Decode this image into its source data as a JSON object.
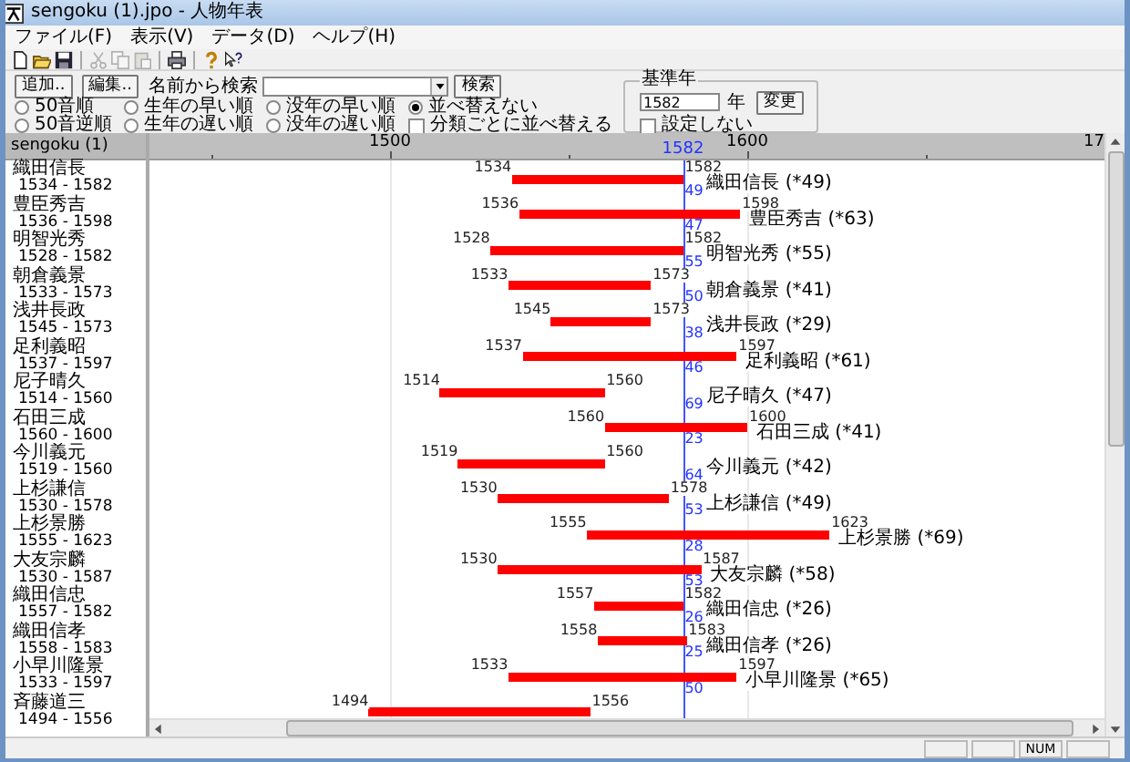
{
  "window": {
    "title": "sengoku (1).jpo - 人物年表"
  },
  "menu": [
    {
      "label": "ファイル(F)"
    },
    {
      "label": "表示(V)"
    },
    {
      "label": "データ(D)"
    },
    {
      "label": "ヘルプ(H)"
    }
  ],
  "toolbar": [
    {
      "kind": "new",
      "disabled": false
    },
    {
      "kind": "open",
      "disabled": false
    },
    {
      "kind": "save",
      "disabled": false
    },
    {
      "kind": "sep"
    },
    {
      "kind": "cut",
      "disabled": true
    },
    {
      "kind": "copy",
      "disabled": true
    },
    {
      "kind": "paste",
      "disabled": true
    },
    {
      "kind": "sep"
    },
    {
      "kind": "print",
      "disabled": false
    },
    {
      "kind": "sep"
    },
    {
      "kind": "help",
      "disabled": false
    },
    {
      "kind": "context-help",
      "disabled": false
    }
  ],
  "controls": {
    "buttons": [
      "追加..",
      "編集.."
    ],
    "search_label": "名前から検索",
    "search_button": "検索",
    "sort_options": [
      {
        "label": "50音順",
        "selected": false
      },
      {
        "label": "50音逆順",
        "selected": false
      },
      {
        "label": "生年の早い順",
        "selected": false
      },
      {
        "label": "生年の遅い順",
        "selected": false
      },
      {
        "label": "没年の早い順",
        "selected": false
      },
      {
        "label": "没年の遅い順",
        "selected": false
      },
      {
        "label": "並べ替えない",
        "selected": true
      }
    ],
    "group_sort": {
      "label": "分類ごとに並べ替える",
      "checked": false
    }
  },
  "base_year": {
    "title": "基準年",
    "value": "1582",
    "unit": "年",
    "button": "変更",
    "no_set": {
      "label": "設定しない",
      "checked": false
    }
  },
  "list": {
    "header": "sengoku (1)",
    "items": [
      {
        "name": "織田信長",
        "years": "1534 - 1582"
      },
      {
        "name": "豊臣秀吉",
        "years": "1536 - 1598"
      },
      {
        "name": "明智光秀",
        "years": "1528 - 1582"
      },
      {
        "name": "朝倉義景",
        "years": "1533 - 1573"
      },
      {
        "name": "浅井長政",
        "years": "1545 - 1573"
      },
      {
        "name": "足利義昭",
        "years": "1537 - 1597"
      },
      {
        "name": "尼子晴久",
        "years": "1514 - 1560"
      },
      {
        "name": "石田三成",
        "years": "1560 - 1600"
      },
      {
        "name": "今川義元",
        "years": "1519 - 1560"
      },
      {
        "name": "上杉謙信",
        "years": "1530 - 1578"
      },
      {
        "name": "上杉景勝",
        "years": "1555 - 1623"
      },
      {
        "name": "大友宗麟",
        "years": "1530 - 1587"
      },
      {
        "name": "織田信忠",
        "years": "1557 - 1582"
      },
      {
        "name": "織田信孝",
        "years": "1558 - 1583"
      },
      {
        "name": "小早川隆景",
        "years": "1533 - 1597"
      },
      {
        "name": "斉藤道三",
        "years": "1494 - 1556"
      }
    ]
  },
  "timeline": {
    "axis": [
      "1500",
      "1600",
      "17"
    ],
    "reference": "1582",
    "rows": [
      {
        "start": "1534",
        "end": "1582",
        "label": "織田信長 (*49)",
        "age": "49"
      },
      {
        "start": "1536",
        "end": "1598",
        "label": "豊臣秀吉 (*63)",
        "age": "47"
      },
      {
        "start": "1528",
        "end": "1582",
        "label": "明智光秀 (*55)",
        "age": "55"
      },
      {
        "start": "1533",
        "end": "1573",
        "label": "朝倉義景 (*41)",
        "age": "50"
      },
      {
        "start": "1545",
        "end": "1573",
        "label": "浅井長政 (*29)",
        "age": "38"
      },
      {
        "start": "1537",
        "end": "1597",
        "label": "足利義昭 (*61)",
        "age": "46"
      },
      {
        "start": "1514",
        "end": "1560",
        "label": "尼子晴久 (*47)",
        "age": "69"
      },
      {
        "start": "1560",
        "end": "1600",
        "label": "石田三成 (*41)",
        "age": "23"
      },
      {
        "start": "1519",
        "end": "1560",
        "label": "今川義元 (*42)",
        "age": "64"
      },
      {
        "start": "1530",
        "end": "1578",
        "label": "上杉謙信 (*49)",
        "age": "53"
      },
      {
        "start": "1555",
        "end": "1623",
        "label": "上杉景勝 (*69)",
        "age": "28"
      },
      {
        "start": "1530",
        "end": "1587",
        "label": "大友宗麟 (*58)",
        "age": "53"
      },
      {
        "start": "1557",
        "end": "1582",
        "label": "織田信忠 (*26)",
        "age": "26"
      },
      {
        "start": "1558",
        "end": "1583",
        "label": "織田信孝 (*26)",
        "age": "25"
      },
      {
        "start": "1533",
        "end": "1597",
        "label": "小早川隆景 (*65)",
        "age": "50"
      },
      {
        "start": "1494",
        "end": "1556"
      }
    ]
  },
  "status_bar": {
    "num": "NUM"
  }
}
